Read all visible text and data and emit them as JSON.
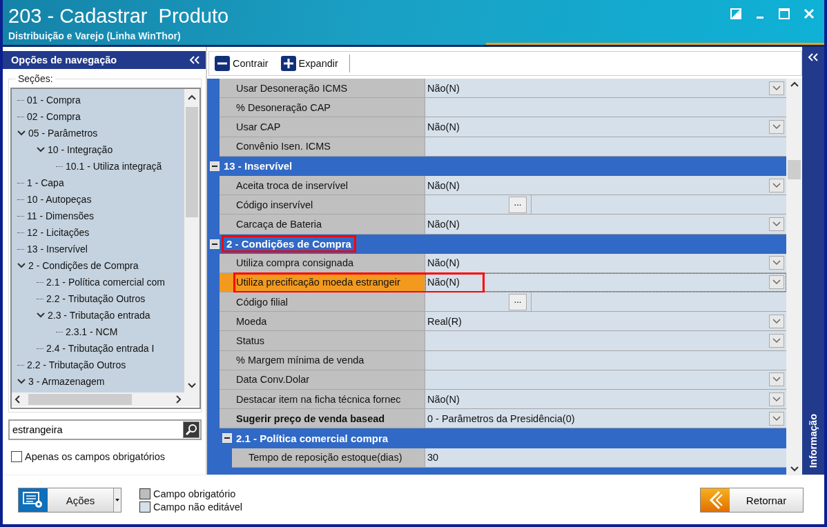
{
  "window": {
    "title": "203 - Cadastrar  Produto",
    "subtitle": "Distribuição e Varejo (Linha WinThor)"
  },
  "navigation": {
    "title": "Opções de navegação",
    "sections_label": "Seções:",
    "tree": [
      {
        "label": "01 - Compra"
      },
      {
        "label": "02 - Compra"
      },
      {
        "label": "05 - Parâmetros",
        "expanded": true,
        "children": [
          {
            "label": "10 - Integração",
            "expanded": true,
            "children": [
              {
                "label": "10.1 - Utiliza integraçã"
              }
            ]
          }
        ]
      },
      {
        "label": "1 - Capa"
      },
      {
        "label": "10 - Autopeças"
      },
      {
        "label": "11 - Dimensões"
      },
      {
        "label": "12 - Licitações"
      },
      {
        "label": "13 - Inservível"
      },
      {
        "label": "2 - Condições de Compra",
        "expanded": true,
        "children": [
          {
            "label": "2.1 - Política comercial com"
          },
          {
            "label": "2.2 - Tributação Outros"
          },
          {
            "label": "2.3 - Tributação entrada",
            "expanded": true,
            "children": [
              {
                "label": "2.3.1 - NCM"
              }
            ]
          },
          {
            "label": "2.4 - Tributação entrada I"
          }
        ]
      },
      {
        "label": "2.2 - Tributação Outros"
      },
      {
        "label": "3 - Armazenagem",
        "expanded": true
      }
    ],
    "search": {
      "value": "estrangeira"
    },
    "required_only": {
      "label": "Apenas os campos obrigatórios",
      "checked": false
    }
  },
  "toolbar": {
    "buttons": [
      {
        "label": "Contrair",
        "kind": "collapse"
      },
      {
        "label": "Expandir",
        "kind": "expand"
      }
    ]
  },
  "grid": {
    "sections": [
      {
        "rows": [
          {
            "label": "Usar Desoneração ICMS",
            "value": "Não(N)",
            "kind": "dropdown",
            "selected": false,
            "required": false,
            "annotated": false
          },
          {
            "label": "% Desoneração CAP",
            "kind": "text",
            "selected": false,
            "required": false,
            "annotated": false
          },
          {
            "label": "Usar CAP",
            "value": "Não(N)",
            "kind": "dropdown",
            "selected": false,
            "required": false,
            "annotated": false
          },
          {
            "label": "Convênio Isen. ICMS",
            "kind": "text",
            "selected": false,
            "required": false,
            "annotated": false
          }
        ]
      },
      {
        "title": "13 - Inservível",
        "expanded": true,
        "annotated": false,
        "rows": [
          {
            "label": "Aceita troca de inservível",
            "value": "Não(N)",
            "kind": "dropdown",
            "selected": false,
            "required": false,
            "annotated": false
          },
          {
            "label": "Código inservível",
            "kind": "lookup",
            "button": "...",
            "selected": false,
            "required": false,
            "annotated": false
          },
          {
            "label": "Carcaça de Bateria",
            "value": "Não(N)",
            "kind": "dropdown",
            "selected": false,
            "required": false,
            "annotated": false
          }
        ]
      },
      {
        "title": "2 - Condições de Compra",
        "expanded": true,
        "annotated": true,
        "rows": [
          {
            "label": "Utiliza compra consignada",
            "value": "Não(N)",
            "kind": "dropdown",
            "selected": false,
            "required": false,
            "annotated": false
          },
          {
            "label": "Utiliza precificação moeda estrangeir",
            "value": "Não(N)",
            "kind": "dropdown",
            "selected": true,
            "required": false,
            "annotated": true
          },
          {
            "label": "Código filial",
            "kind": "lookup",
            "button": "...",
            "selected": false,
            "required": false,
            "annotated": false
          },
          {
            "label": "Moeda",
            "value": "Real(R)",
            "kind": "dropdown",
            "selected": false,
            "required": false,
            "annotated": false
          },
          {
            "label": "Status",
            "kind": "dropdown",
            "selected": false,
            "required": false,
            "annotated": false
          },
          {
            "label": "% Margem mínima de venda",
            "kind": "text",
            "selected": false,
            "required": false,
            "annotated": false
          },
          {
            "label": "Data Conv.Dolar",
            "kind": "dropdown",
            "selected": false,
            "required": false,
            "annotated": false
          },
          {
            "label": "Destacar item na ficha técnica fornec",
            "value": "Não(N)",
            "kind": "dropdown",
            "selected": false,
            "required": false,
            "annotated": false
          },
          {
            "label": "Sugerir preço de venda basead",
            "value": "0 - Parâmetros da Presidência(0)",
            "kind": "dropdown",
            "selected": false,
            "required": true,
            "annotated": false
          }
        ],
        "children": [
          {
            "title": "2.1 - Política comercial compra",
            "expanded": true,
            "annotated": false,
            "rows": [
              {
                "label": "Tempo de reposição estoque(dias)",
                "value": "30",
                "kind": "text",
                "selected": false,
                "required": false,
                "annotated": false
              }
            ]
          }
        ]
      }
    ]
  },
  "info_panel": {
    "title": "Informação"
  },
  "footer": {
    "actions": {
      "label": "Ações"
    },
    "legend": [
      {
        "label": "Campo obrigatório",
        "color": "#bdbdbd"
      },
      {
        "label": "Campo não editável",
        "color": "#d6e0ea"
      }
    ],
    "back": {
      "label": "Retornar"
    }
  }
}
